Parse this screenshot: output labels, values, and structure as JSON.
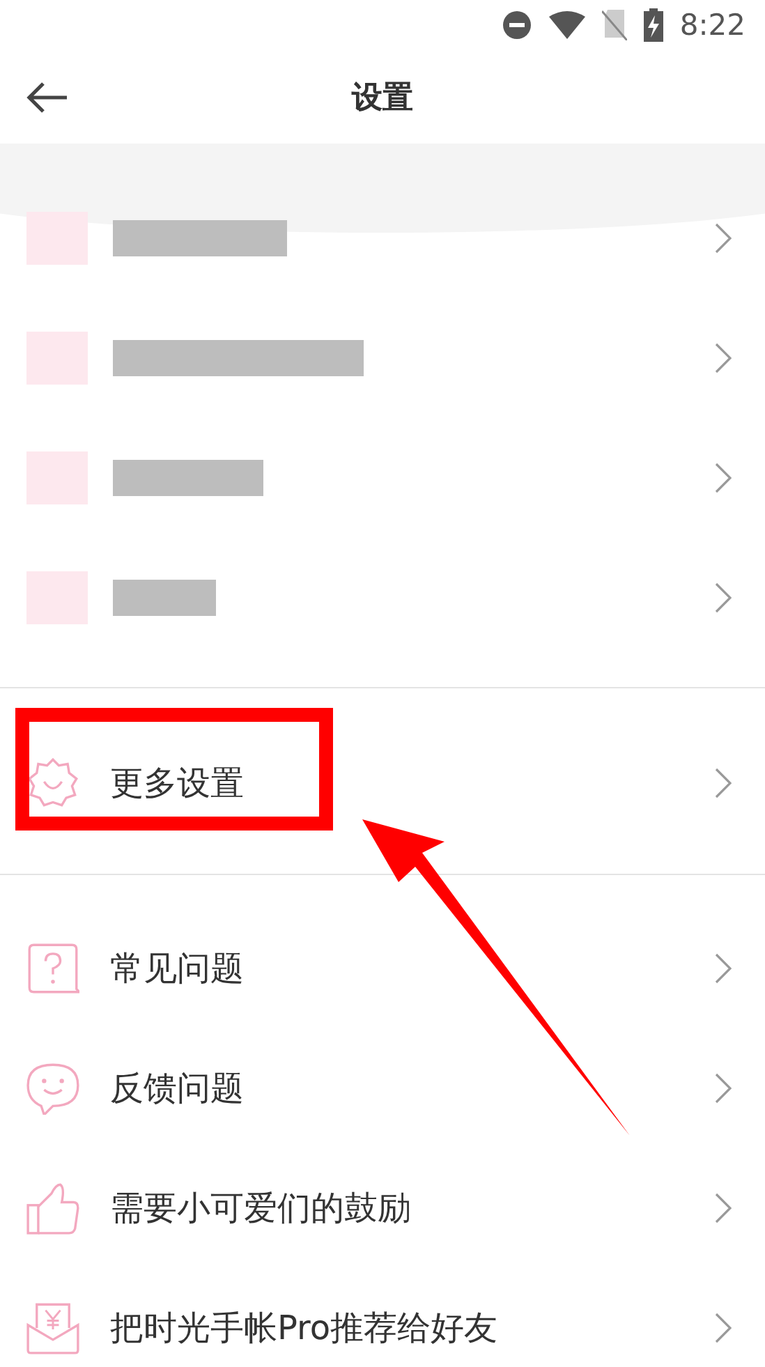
{
  "status_bar": {
    "time": "8:22"
  },
  "header": {
    "title": "设置"
  },
  "sections": [
    {
      "items": [
        {
          "kind": "blurred"
        },
        {
          "kind": "blurred"
        },
        {
          "kind": "blurred"
        },
        {
          "kind": "blurred"
        }
      ]
    },
    {
      "items": [
        {
          "kind": "entry",
          "label": "更多设置"
        }
      ]
    },
    {
      "items": [
        {
          "kind": "entry",
          "label": "常见问题"
        },
        {
          "kind": "entry",
          "label": "反馈问题"
        },
        {
          "kind": "entry",
          "label": "需要小可爱们的鼓励"
        },
        {
          "kind": "entry",
          "label": "把时光手帐Pro推荐给好友"
        }
      ]
    }
  ],
  "annotation": {
    "highlight_box": true,
    "arrow": true
  }
}
